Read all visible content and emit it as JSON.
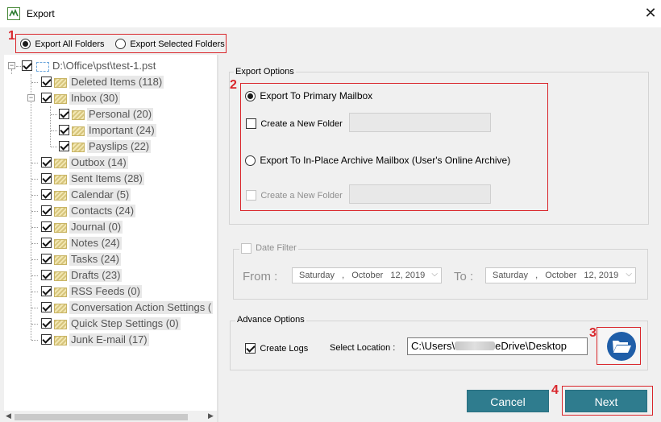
{
  "window": {
    "title": "Export",
    "close_glyph": "✕"
  },
  "annotations": {
    "n1": "1",
    "n2": "2",
    "n3": "3",
    "n4": "4"
  },
  "export_mode": {
    "all_label": "Export All Folders",
    "selected_label": "Export Selected Folders",
    "selected": "all"
  },
  "tree": {
    "root_toggle": "−",
    "root": "D:\\Office\\pst\\test-1.pst",
    "deleted": "Deleted Items (118)",
    "inbox_toggle": "−",
    "inbox": "Inbox (30)",
    "personal": "Personal (20)",
    "important": "Important (24)",
    "payslips": "Payslips (22)",
    "outbox": "Outbox (14)",
    "sent": "Sent Items (28)",
    "calendar": "Calendar (5)",
    "contacts": "Contacts (24)",
    "journal": "Journal (0)",
    "notes": "Notes (24)",
    "tasks": "Tasks (24)",
    "drafts": "Drafts (23)",
    "rss": "RSS Feeds (0)",
    "conversation": "Conversation Action Settings (",
    "quickstep": "Quick Step Settings (0)",
    "junk": "Junk E-mail (17)"
  },
  "scroll": {
    "left": "◀",
    "right": "▶"
  },
  "export_options": {
    "group_title": "Export Options",
    "primary_label": "Export To Primary Mailbox",
    "create_folder_label": "Create a New Folder",
    "archive_label": "Export To In-Place Archive Mailbox (User's Online Archive)",
    "create_folder_label2": "Create a New Folder"
  },
  "date_filter": {
    "label": "Date Filter",
    "from_label": "From :",
    "to_label": "To :",
    "from_day": "Saturday",
    "from_sep": ",",
    "from_month": "October",
    "from_date": "12, 2019",
    "to_day": "Saturday",
    "to_sep": ",",
    "to_month": "October",
    "to_date": "12, 2019",
    "chevron": "⌵"
  },
  "advance_options": {
    "group_title": "Advance Options",
    "create_logs_label": "Create Logs",
    "select_location_label": "Select Location :",
    "path_prefix": "C:\\Users\\",
    "path_suffix": "eDrive\\Desktop"
  },
  "buttons": {
    "cancel": "Cancel",
    "next": "Next"
  },
  "colors": {
    "accent": "#2f7c8e",
    "annotation": "#d9262b",
    "browse": "#1f5ea8"
  }
}
